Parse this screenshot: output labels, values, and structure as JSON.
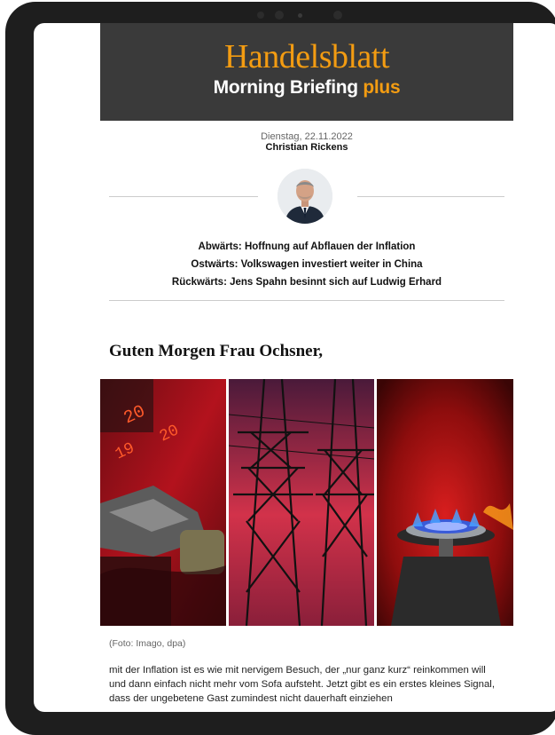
{
  "header": {
    "brand": "Handelsblatt",
    "product_main": "Morning Briefing",
    "product_plus": "plus"
  },
  "meta": {
    "date": "Dienstag, 22.11.2022",
    "author": "Christian Rickens"
  },
  "headlines": [
    "Abwärts: Hoffnung auf Abflauen der Inflation",
    "Ostwärts: Volkswagen investiert weiter in China",
    "Rückwärts: Jens Spahn besinnt sich auf Ludwig Erhard"
  ],
  "greeting": "Guten Morgen Frau Ochsner,",
  "photo_caption": "(Foto: Imago, dpa)",
  "body": {
    "paragraph": "mit der Inflation ist es wie mit nervigem Besuch, der „nur ganz kurz“ reinkommen will und dann einfach nicht mehr vom Sofa aufsteht. Jetzt gibt es ein erstes kleines Signal, dass der ungebetene Gast zumindest nicht dauerhaft einziehen"
  },
  "colors": {
    "brand_orange": "#f39c12",
    "masthead_bg": "#3a3a3a",
    "device_frame": "#1e1e1e"
  },
  "photos": [
    {
      "subject": "fuel-nozzle-photo"
    },
    {
      "subject": "power-pylon-photo"
    },
    {
      "subject": "gas-flame-photo"
    }
  ]
}
